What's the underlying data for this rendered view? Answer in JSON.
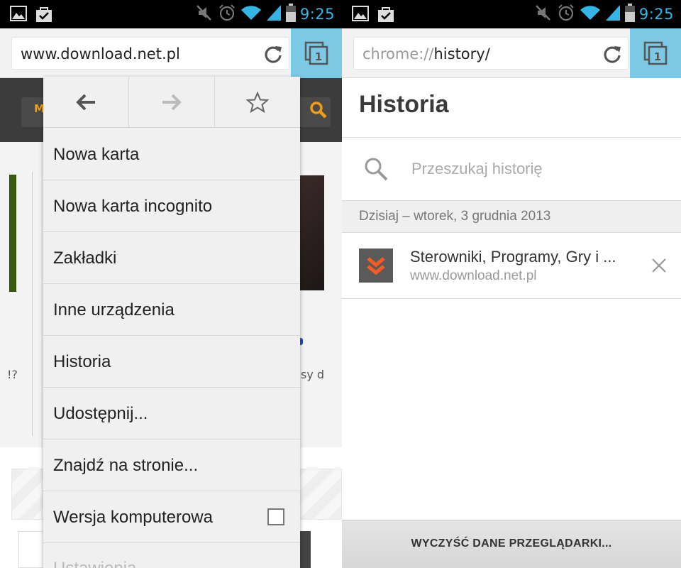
{
  "status_bar": {
    "time": "9:25",
    "left_icons": [
      "image-icon",
      "shopping-bag-icon"
    ],
    "right_icons": [
      "mute-icon",
      "alarm-icon",
      "wifi-icon",
      "signal-icon",
      "battery-icon"
    ]
  },
  "left_screen": {
    "omnibox": {
      "url": "www.download.net.pl"
    },
    "tabs_count": "1",
    "page_fragments": {
      "logo_letter": "M",
      "text_left": "!?",
      "text_right": "sy d"
    },
    "menu": {
      "nav": [
        "back-arrow-icon",
        "forward-arrow-icon",
        "star-icon"
      ],
      "items": [
        {
          "label": "Nowa karta"
        },
        {
          "label": "Nowa karta incognito"
        },
        {
          "label": "Zakładki"
        },
        {
          "label": "Inne urządzenia"
        },
        {
          "label": "Historia"
        },
        {
          "label": "Udostępnij..."
        },
        {
          "label": "Znajdź na stronie..."
        },
        {
          "label": "Wersja komputerowa",
          "checkbox": false
        },
        {
          "label": "Ustawienia"
        }
      ]
    }
  },
  "right_screen": {
    "omnibox": {
      "url_prefix": "chrome://",
      "url_path": "history/"
    },
    "tabs_count": "1",
    "title": "Historia",
    "search": {
      "placeholder": "Przeszukaj historię"
    },
    "date_header": "Dzisiaj – wtorek, 3 grudnia 2013",
    "entries": [
      {
        "title": "Sterowniki, Programy, Gry i ...",
        "url": "www.download.net.pl"
      }
    ],
    "clear_button": "WYCZYŚĆ DANE PRZEGLĄDARKI..."
  },
  "colors": {
    "accent": "#33b5e5",
    "tabs_button": "#7cc9e6",
    "favicon_orange": "#ff5a1f"
  }
}
